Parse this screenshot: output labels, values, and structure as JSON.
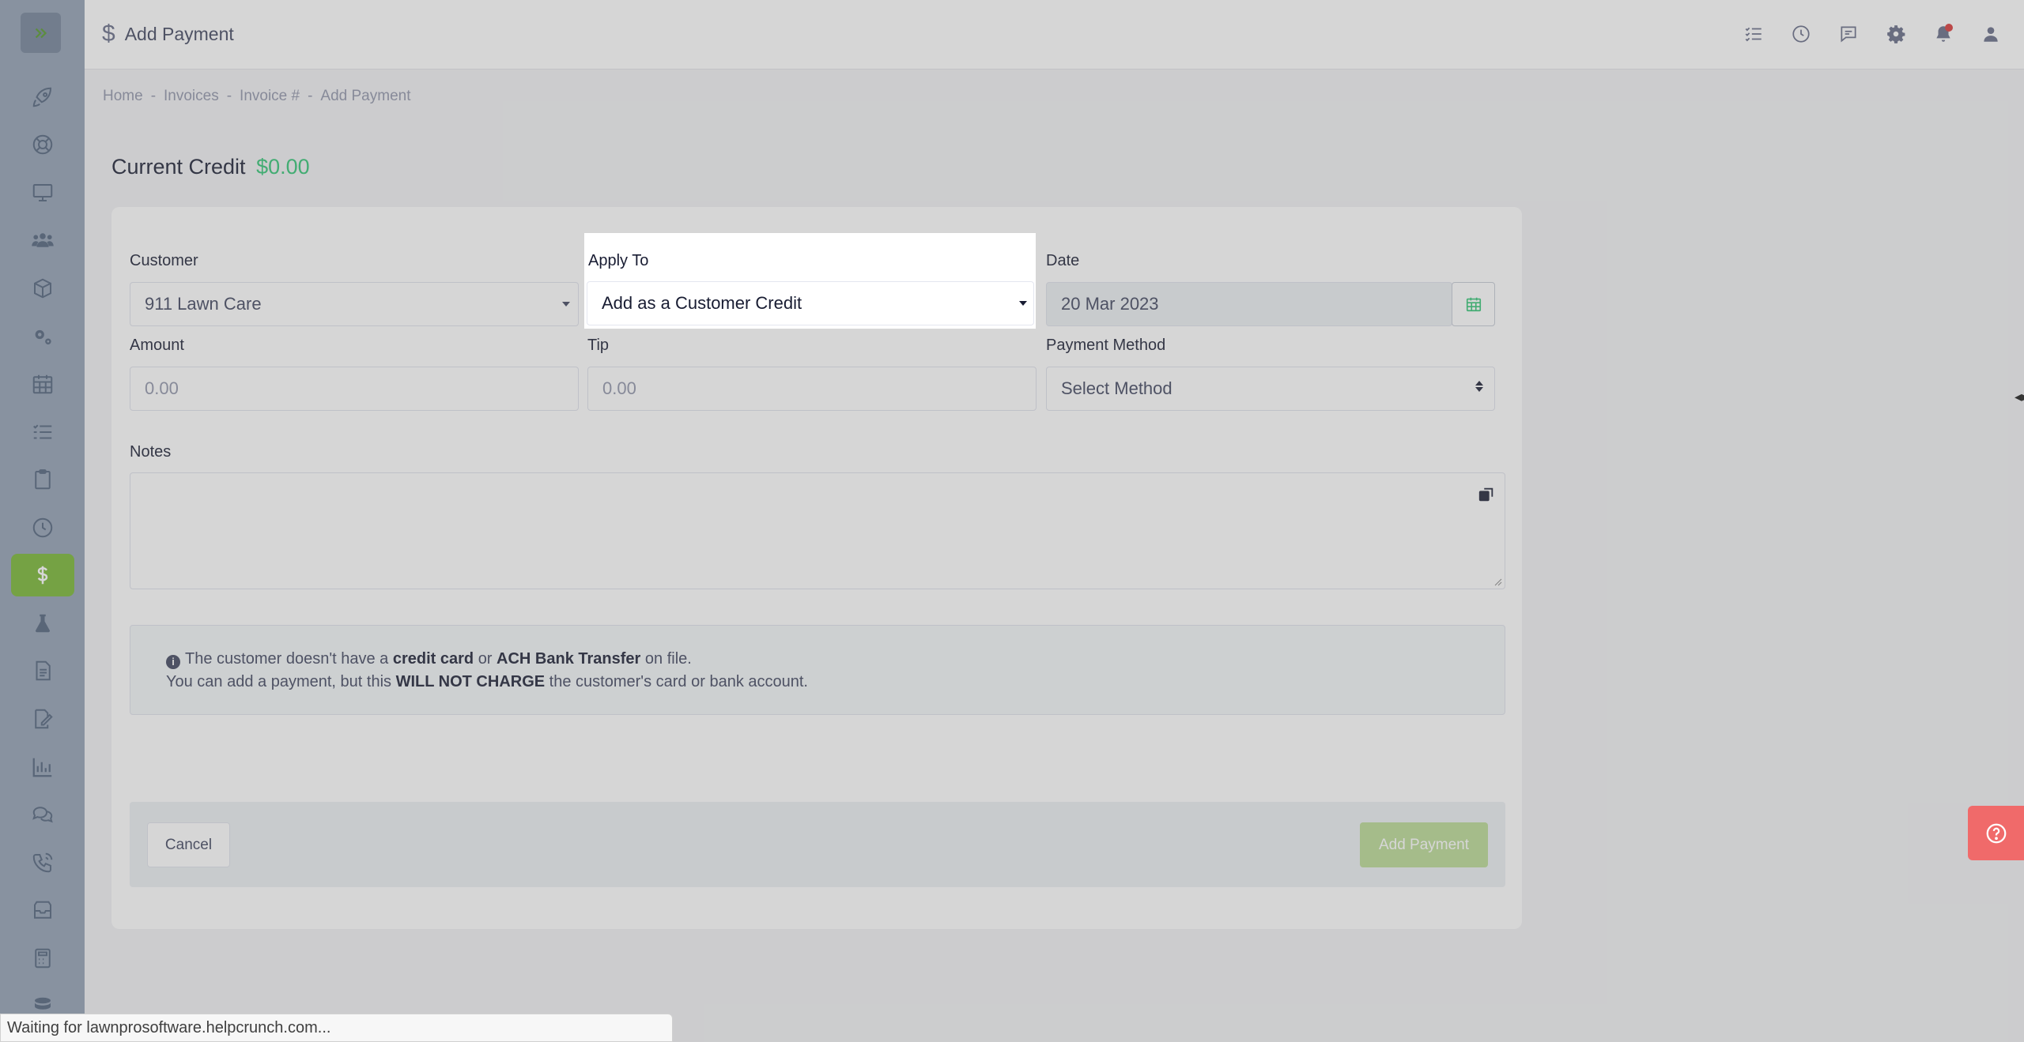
{
  "header": {
    "title": "Add Payment"
  },
  "breadcrumb": [
    "Home",
    "Invoices",
    "Invoice #",
    "Add Payment"
  ],
  "breadcrumb_separator": "-",
  "current_credit": {
    "label": "Current Credit",
    "amount": "$0.00"
  },
  "form": {
    "customer": {
      "label": "Customer",
      "value": "911 Lawn Care"
    },
    "apply_to": {
      "label": "Apply To",
      "value": "Add as a Customer Credit"
    },
    "date": {
      "label": "Date",
      "value": "20 Mar 2023"
    },
    "amount": {
      "label": "Amount",
      "placeholder": "0.00"
    },
    "tip": {
      "label": "Tip",
      "placeholder": "0.00"
    },
    "payment_method": {
      "label": "Payment Method",
      "value": "Select Method"
    },
    "notes": {
      "label": "Notes",
      "value": ""
    }
  },
  "alert": {
    "line1_pre": "The customer doesn't have a",
    "line1_b1": "credit card",
    "line1_mid": "or",
    "line1_b2": "ACH Bank Transfer",
    "line1_post": "on file.",
    "line2_pre": "You can add a payment, but this",
    "line2_b": "WILL NOT CHARGE",
    "line2_post": "the customer's card or bank account."
  },
  "buttons": {
    "cancel": "Cancel",
    "add_payment": "Add Payment"
  },
  "status_bar": "Waiting for lawnprosoftware.helpcrunch.com...",
  "colors": {
    "accent_green": "#8cc152",
    "credit_green": "#50cd89",
    "help_red": "#f06a6a"
  },
  "sidebar_icons": [
    "rocket-icon",
    "lifebuoy-icon",
    "monitor-icon",
    "users-icon",
    "box-icon",
    "gears-icon",
    "calendar-icon",
    "list-icon",
    "clipboard-icon",
    "clock-icon",
    "dollar-icon",
    "flask-icon",
    "document-icon",
    "signature-icon",
    "bar-chart-icon",
    "chat-icon",
    "phone-icon",
    "inbox-icon",
    "calculator-icon",
    "database-icon"
  ]
}
